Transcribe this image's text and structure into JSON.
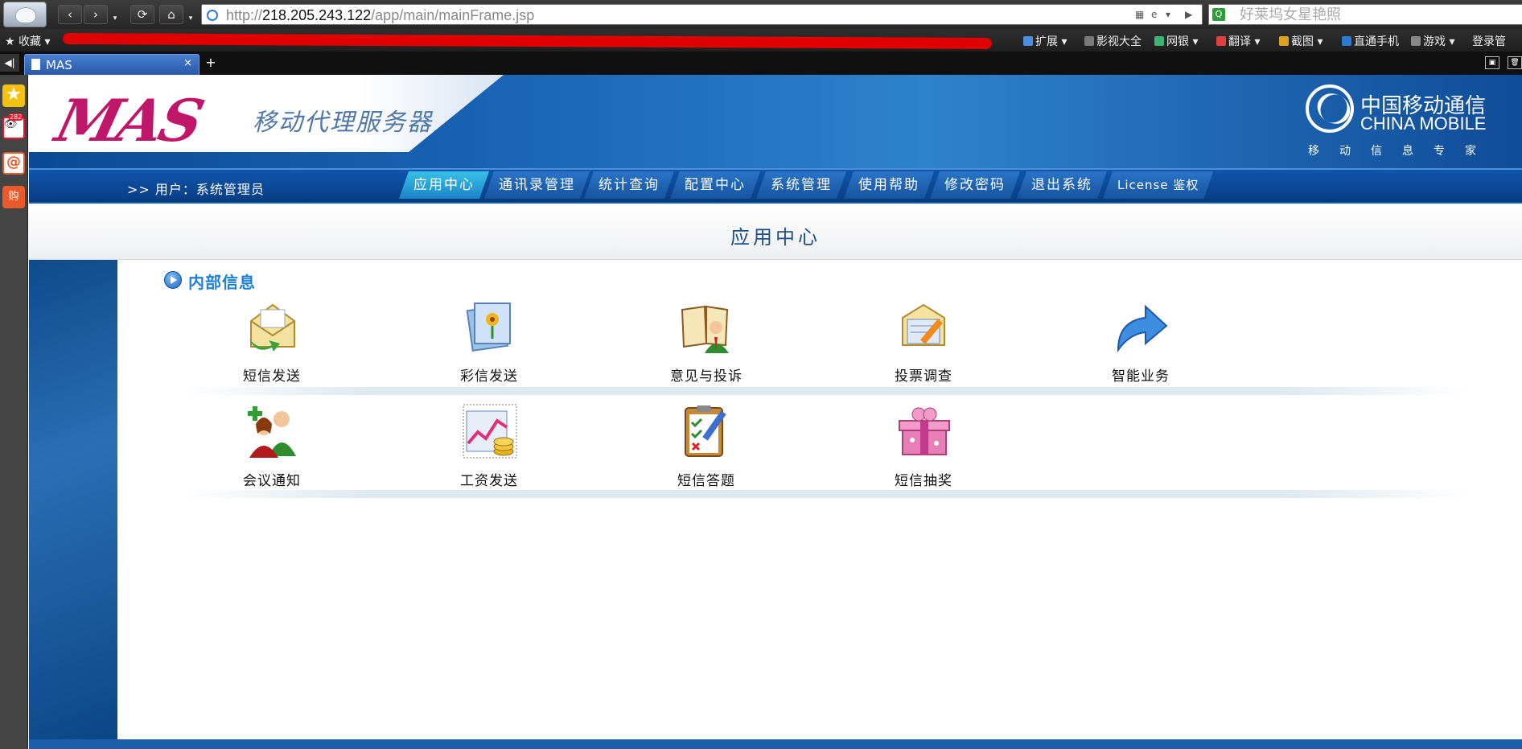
{
  "browser": {
    "address": {
      "scheme": "http://",
      "host": "218.205.243.122",
      "path": "/app/main/mainFrame.jsp"
    },
    "search_placeholder": "好莱坞女星艳照",
    "bookmarks_label": "收藏",
    "bookmarks_right": [
      "扩展",
      "影视大全",
      "网银",
      "翻译",
      "截图",
      "直通手机",
      "游戏",
      "登录管"
    ],
    "tab_title": "MAS"
  },
  "sidebar": {
    "weibo_badge": "282",
    "shop_label": "购"
  },
  "header": {
    "logo": "MAS",
    "subtitle": "移动代理服务器",
    "brand_cn": "中国移动通信",
    "brand_en": "CHINA MOBILE",
    "slogan": "移动信息专家"
  },
  "nav": {
    "user_label": ">> 用户：系统管理员",
    "items": [
      "应用中心",
      "通讯录管理",
      "统计查询",
      "配置中心",
      "系统管理",
      "使用帮助",
      "修改密码",
      "退出系统",
      "License 鉴权"
    ],
    "active": "应用中心"
  },
  "content": {
    "title": "应用中心",
    "section_title": "内部信息",
    "apps": [
      {
        "label": "短信发送",
        "icon": "envelope-icon"
      },
      {
        "label": "彩信发送",
        "icon": "picture-icon"
      },
      {
        "label": "意见与投诉",
        "icon": "book-person-icon"
      },
      {
        "label": "投票调查",
        "icon": "envelope-pencil-icon"
      },
      {
        "label": "智能业务",
        "icon": "arrow-icon"
      },
      {
        "label": "会议通知",
        "icon": "people-icon"
      },
      {
        "label": "工资发送",
        "icon": "chart-coins-icon"
      },
      {
        "label": "短信答题",
        "icon": "clipboard-icon"
      },
      {
        "label": "短信抽奖",
        "icon": "gift-icon"
      }
    ]
  }
}
